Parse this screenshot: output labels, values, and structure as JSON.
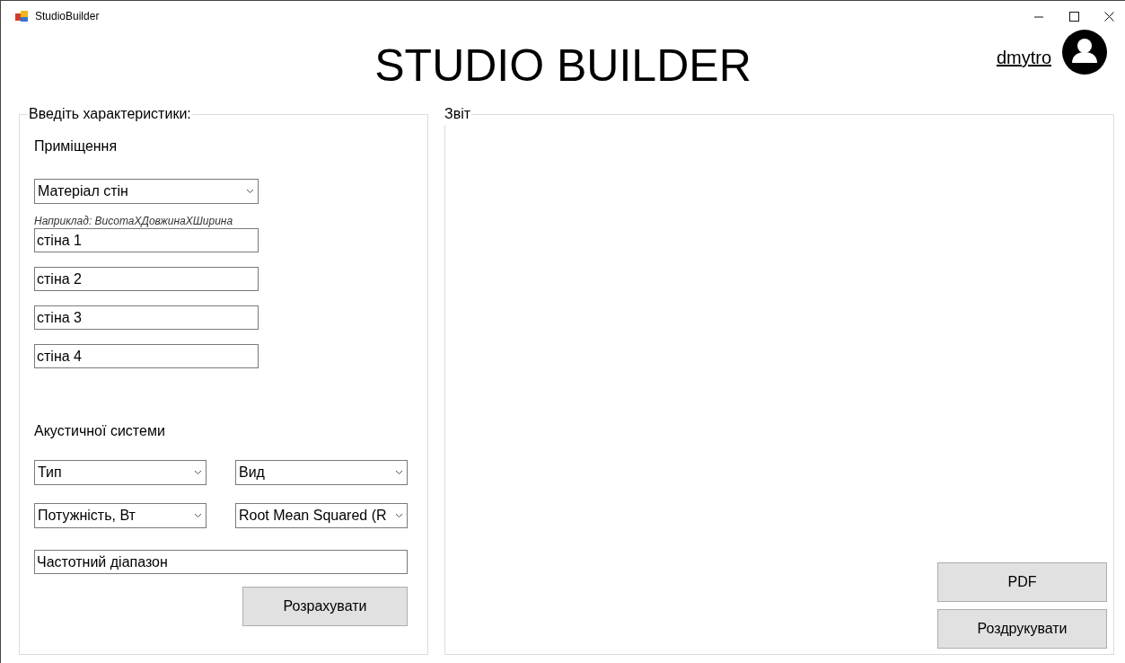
{
  "window": {
    "title": "StudioBuilder"
  },
  "header": {
    "title": "STUDIO BUILDER",
    "user": "dmytro"
  },
  "input_group": {
    "title": "Введіть характеристики:",
    "room": {
      "label": "Приміщення",
      "wall_material": "Матеріал стін",
      "hint": "Наприклад: ВисотаХДовжинаХШирина",
      "walls": [
        "стіна 1",
        "стіна 2",
        "стіна 3",
        "стіна 4"
      ]
    },
    "speakers": {
      "label": "Акустичної системи",
      "fields": [
        {
          "kind": "select",
          "value": "Тип"
        },
        {
          "kind": "select",
          "value": "Вид"
        },
        {
          "kind": "select",
          "value": "Потужність, Вт"
        },
        {
          "kind": "select",
          "value": "Root Mean Squared (R"
        },
        {
          "kind": "text",
          "value": "Частотний діапазон"
        }
      ]
    },
    "calculate_button": "Розрахувати"
  },
  "report": {
    "title": "Звіт",
    "buttons": [
      "PDF",
      "Роздрукувати"
    ]
  }
}
